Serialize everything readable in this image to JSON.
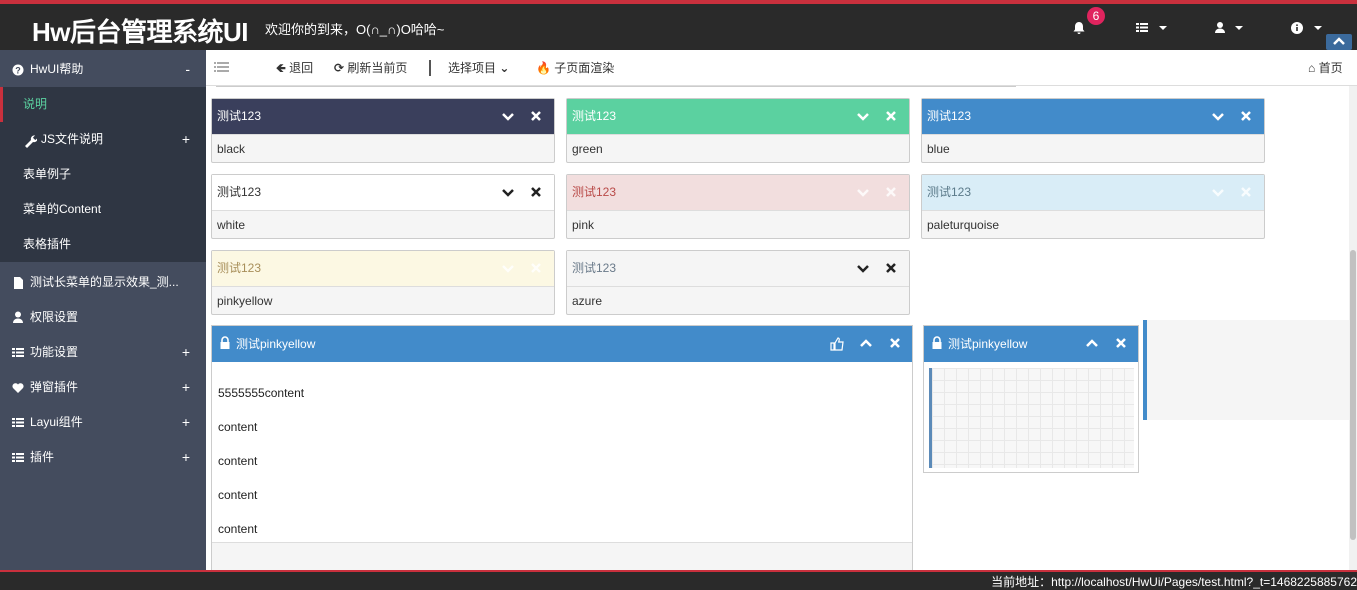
{
  "header": {
    "brand": "Hw后台管理系统UI",
    "welcome": "欢迎你的到来，O(∩_∩)O哈哈~",
    "notification_count": "6"
  },
  "sidebar": {
    "items": [
      {
        "label": "HwUI帮助",
        "icon": "question-circle-icon",
        "toggle": "-"
      },
      {
        "label": "说明"
      },
      {
        "label": "JS文件说明",
        "icon": "wrench-icon",
        "toggle": "+"
      },
      {
        "label": "表单例子"
      },
      {
        "label": "菜单的Content"
      },
      {
        "label": "表格插件"
      },
      {
        "label": "测试长菜单的显示效果_测...",
        "icon": "file-icon"
      },
      {
        "label": "权限设置",
        "icon": "user-icon"
      },
      {
        "label": "功能设置",
        "icon": "list-icon",
        "toggle": "+"
      },
      {
        "label": "弹窗插件",
        "icon": "heart-icon",
        "toggle": "+"
      },
      {
        "label": "Layui组件",
        "icon": "list-icon",
        "toggle": "+"
      },
      {
        "label": "插件",
        "icon": "list-icon",
        "toggle": "+"
      }
    ]
  },
  "toolbar": {
    "back": "退回",
    "refresh": "刷新当前页",
    "select": "选择项目",
    "render": "子页面渲染",
    "home": "首页"
  },
  "cards": [
    {
      "title": "测试123",
      "body": "black",
      "header_bg": "#3a3f5c",
      "header_fg": "#ffffff"
    },
    {
      "title": "测试123",
      "body": "green",
      "header_bg": "#5bd1a0",
      "header_fg": "#ffffff"
    },
    {
      "title": "测试123",
      "body": "blue",
      "header_bg": "#428bca",
      "header_fg": "#ffffff"
    },
    {
      "title": "测试123",
      "body": "white",
      "header_bg": "#ffffff",
      "header_fg": "#333333"
    },
    {
      "title": "测试123",
      "body": "pink",
      "header_bg": "#f2dede",
      "header_fg": "#b94a48"
    },
    {
      "title": "测试123",
      "body": "paleturquoise",
      "header_bg": "#d9edf7",
      "header_fg": "#5b7a8a"
    },
    {
      "title": "测试123",
      "body": "pinkyellow",
      "header_bg": "#fcf8e3",
      "header_fg": "#a88f5a"
    },
    {
      "title": "测试123",
      "body": "azure",
      "header_bg": "#f5f5f5",
      "header_fg": "#6a7a8a"
    }
  ],
  "panel_left": {
    "title": "测试pinkyellow",
    "lines": [
      "5555555content",
      "content",
      "content",
      "content",
      "content"
    ]
  },
  "panel_right": {
    "title": "测试pinkyellow"
  },
  "footer": {
    "address": "当前地址：http://localhost/HwUi/Pages/test.html?_t=1468225885762"
  }
}
